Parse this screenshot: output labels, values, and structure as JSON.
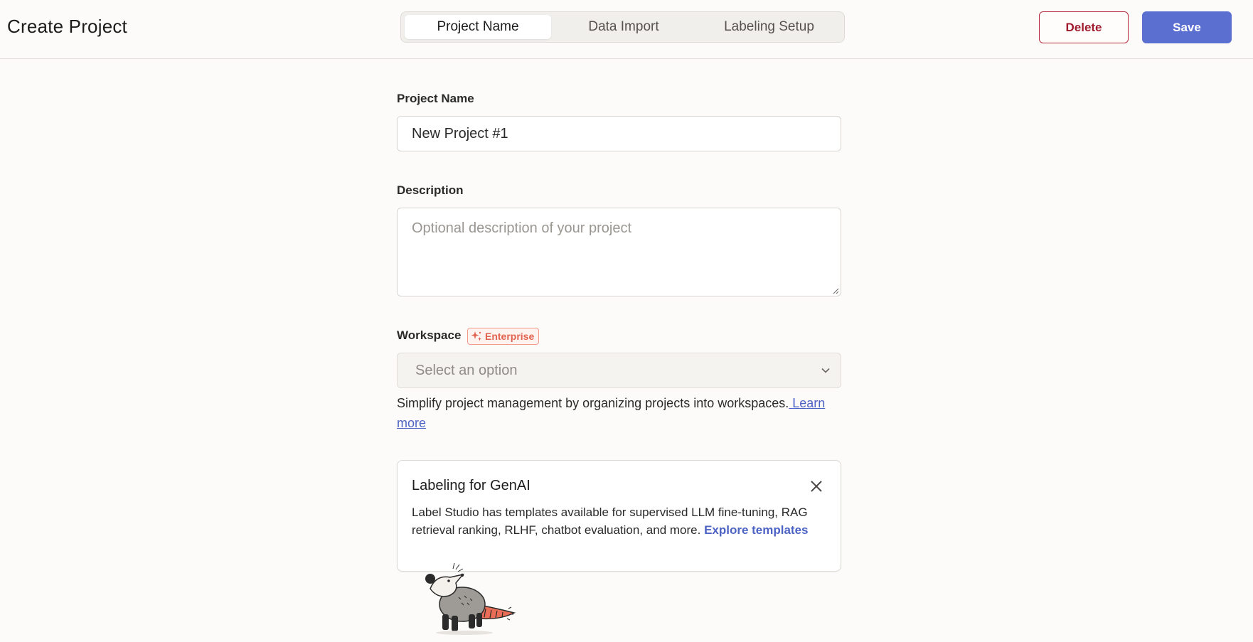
{
  "header": {
    "title": "Create Project",
    "tabs": [
      {
        "label": "Project Name",
        "active": true
      },
      {
        "label": "Data Import",
        "active": false
      },
      {
        "label": "Labeling Setup",
        "active": false
      }
    ],
    "delete_label": "Delete",
    "save_label": "Save"
  },
  "form": {
    "name": {
      "label": "Project Name",
      "value": "New Project #1"
    },
    "description": {
      "label": "Description",
      "placeholder": "Optional description of your project"
    },
    "workspace": {
      "label": "Workspace",
      "badge": "Enterprise",
      "placeholder": "Select an option",
      "help_text": "Simplify project management by organizing projects into workspaces.",
      "help_link": " Learn more"
    }
  },
  "card": {
    "title": "Labeling for GenAI",
    "body": "Label Studio has templates available for supervised LLM fine-tuning, RAG retrieval ranking, RLHF, chatbot evaluation, and more.",
    "link": "Explore templates"
  },
  "colors": {
    "primary": "#5a6fd0",
    "danger": "#a11b2e",
    "badge": "#e0634f",
    "link": "#4d63c4",
    "background": "#fcfbf9"
  },
  "icons": [
    "sparkle-icon",
    "chevron-down-icon",
    "close-icon",
    "opossum-mascot"
  ]
}
